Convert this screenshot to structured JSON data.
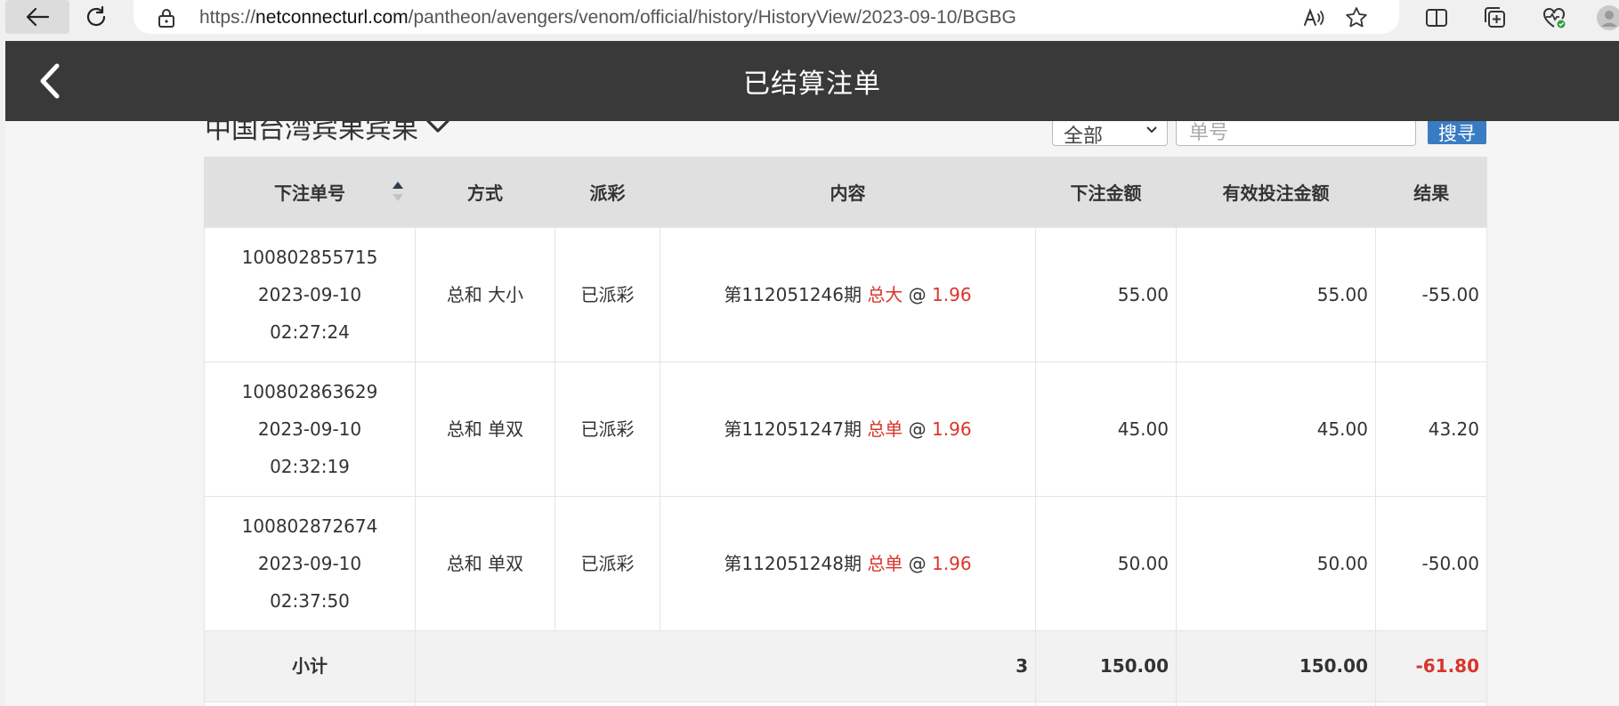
{
  "browser": {
    "url_prefix": "https://",
    "url_domain": "netconnecturl.com",
    "url_path": "/pantheon/avengers/venom/official/history/HistoryView/2023-09-10/BGBG"
  },
  "header": {
    "title": "已结算注单"
  },
  "filters": {
    "region": "中国台湾宾果宾果",
    "type_select": "全部",
    "order_placeholder": "单号",
    "search_label": "搜寻"
  },
  "table": {
    "headers": [
      "下注单号",
      "方式",
      "派彩",
      "内容",
      "下注金额",
      "有效投注金额",
      "结果"
    ],
    "rows": [
      {
        "order_no": "100802855715",
        "date": "2023-09-10",
        "time": "02:27:24",
        "method": "总和 大小",
        "payout": "已派彩",
        "period": "第112051246期",
        "pick": "总大",
        "at": "@",
        "odds": "1.96",
        "amount": "55.00",
        "valid_amount": "55.00",
        "result": "-55.00"
      },
      {
        "order_no": "100802863629",
        "date": "2023-09-10",
        "time": "02:32:19",
        "method": "总和 单双",
        "payout": "已派彩",
        "period": "第112051247期",
        "pick": "总单",
        "at": "@",
        "odds": "1.96",
        "amount": "45.00",
        "valid_amount": "45.00",
        "result": "43.20"
      },
      {
        "order_no": "100802872674",
        "date": "2023-09-10",
        "time": "02:37:50",
        "method": "总和 单双",
        "payout": "已派彩",
        "period": "第112051248期",
        "pick": "总单",
        "at": "@",
        "odds": "1.96",
        "amount": "50.00",
        "valid_amount": "50.00",
        "result": "-50.00"
      }
    ],
    "subtotal": {
      "label": "小计",
      "count": "3",
      "amount": "150.00",
      "valid_amount": "150.00",
      "result": "-61.80"
    }
  },
  "colors": {
    "header_bg": "#393939",
    "accent_red": "#d9352b",
    "search_blue": "#3a7cc3"
  }
}
